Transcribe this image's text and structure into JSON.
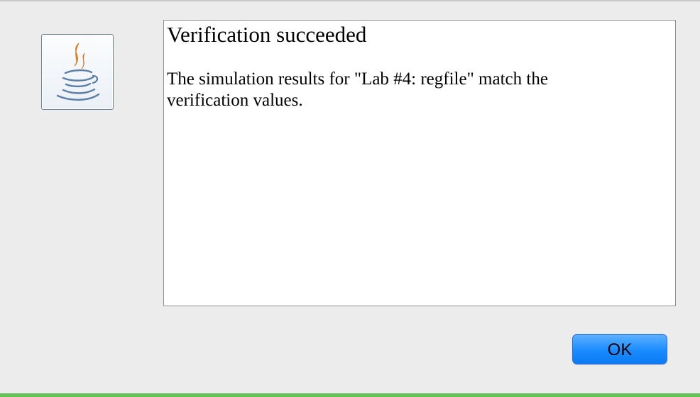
{
  "dialog": {
    "icon": "java-coffee-cup-icon",
    "title": "Verification succeeded",
    "message": "The simulation results for \"Lab #4: regfile\" match the verification values.",
    "ok_label": "OK"
  },
  "colors": {
    "window_background": "#ececec",
    "panel_background": "#ffffff",
    "button_blue": "#1a8cff",
    "java_orange": "#e8741a",
    "java_blue": "#5b7fa6"
  }
}
